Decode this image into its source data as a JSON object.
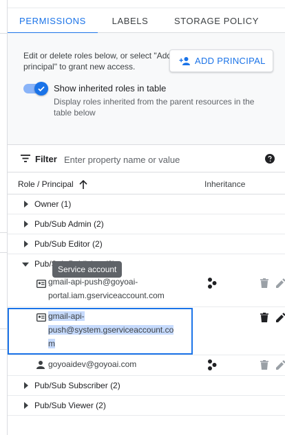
{
  "tabs": [
    {
      "label": "PERMISSIONS",
      "active": true
    },
    {
      "label": "LABELS",
      "active": false
    },
    {
      "label": "STORAGE POLICY",
      "active": false
    }
  ],
  "description": "Edit or delete roles below, or select \"Add principal\" to grant new access.",
  "add_principal": {
    "label": "ADD PRINCIPAL",
    "icon": "person-add-icon"
  },
  "inherited_toggle": {
    "on": true,
    "label": "Show inherited roles in table",
    "sublabel": "Display roles inherited from the parent resources in the table below"
  },
  "filter": {
    "label": "Filter",
    "placeholder": "Enter property name or value",
    "help_icon": "help-icon"
  },
  "table": {
    "col_role": "Role / Principal",
    "col_inheritance": "Inheritance",
    "groups": [
      {
        "label": "Owner (1)",
        "expanded": false
      },
      {
        "label": "Pub/Sub Admin (2)",
        "expanded": false
      },
      {
        "label": "Pub/Sub Editor (2)",
        "expanded": false
      },
      {
        "label": "Pub/Sub Publisher (3)",
        "expanded": true,
        "members": [
          {
            "type": "service-account",
            "lines": [
              "gmail-api-push@goyoai-",
              "portal.iam.gserviceaccount.com"
            ],
            "inherited": true,
            "trash_enabled": false
          },
          {
            "type": "service-account",
            "lines": [
              "gmail-api-",
              "push@system.gserviceaccount.co",
              "m"
            ],
            "inherited": false,
            "trash_enabled": true,
            "selected": true
          },
          {
            "type": "user",
            "lines": [
              "goyoaidev@goyoai.com"
            ],
            "inherited": true,
            "trash_enabled": false
          }
        ]
      },
      {
        "label": "Pub/Sub Subscriber (2)",
        "expanded": false
      },
      {
        "label": "Pub/Sub Viewer (2)",
        "expanded": false
      }
    ]
  },
  "tooltip": "Service account",
  "colors": {
    "accent": "#1a73e8",
    "selection": "#c6dafc",
    "tooltip_bg": "#5f6368"
  }
}
